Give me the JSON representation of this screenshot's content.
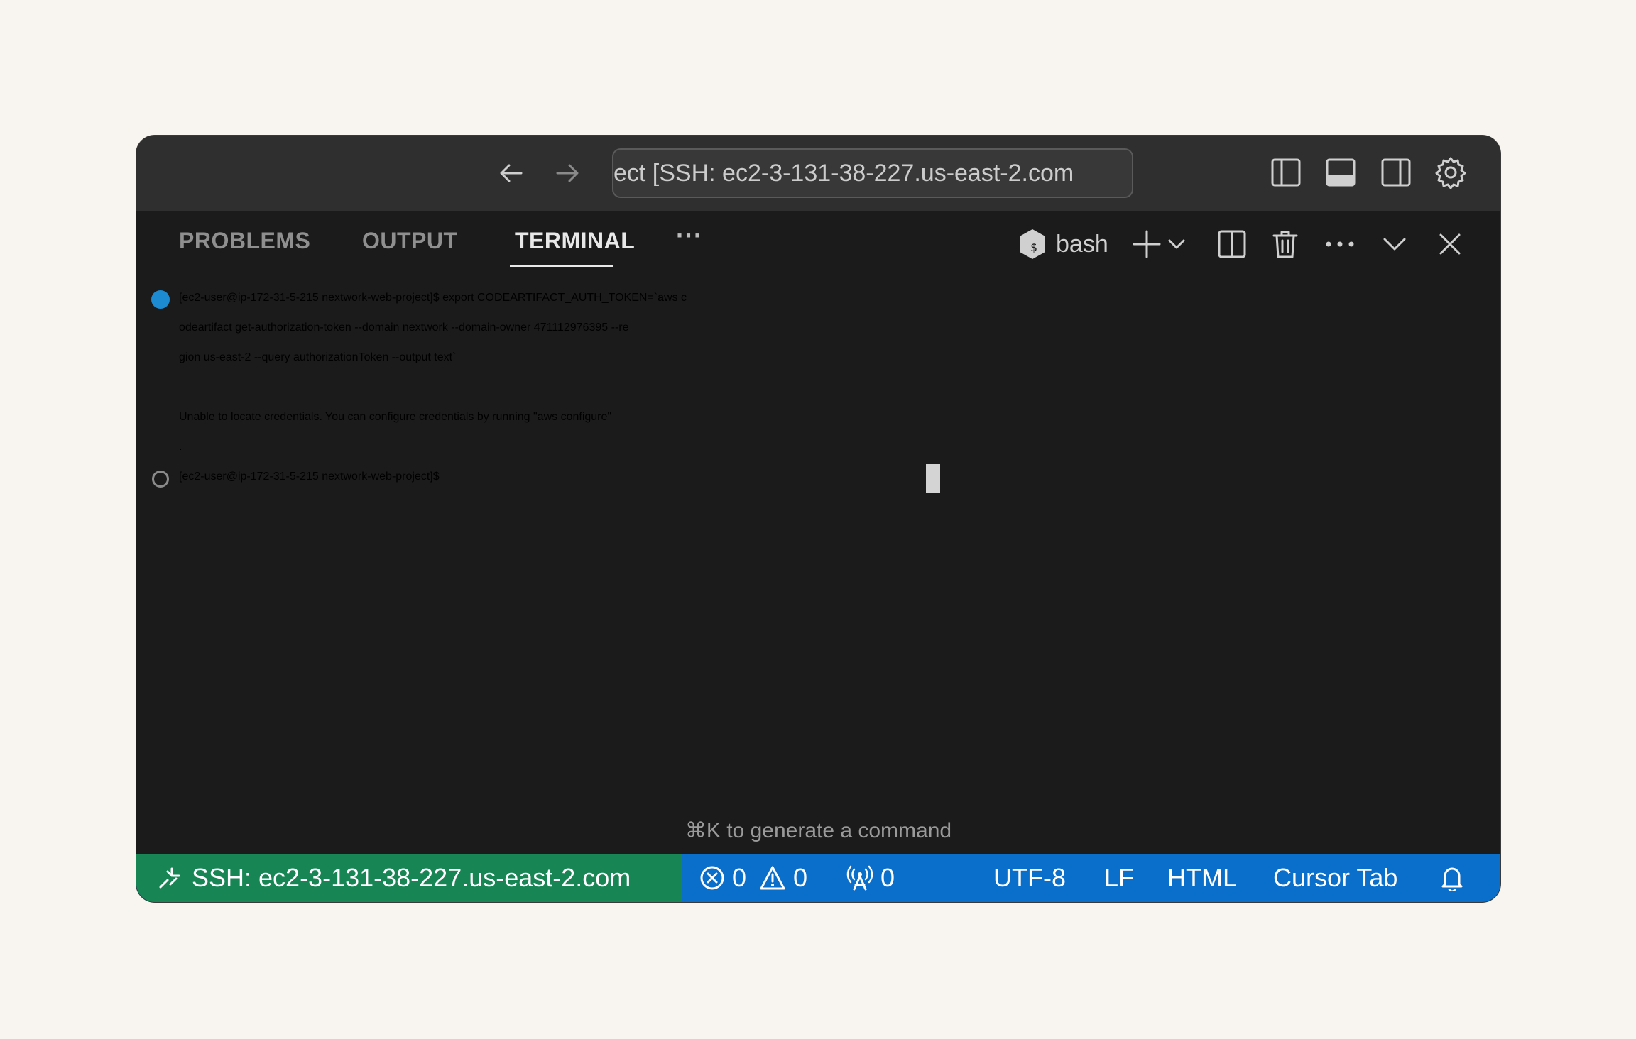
{
  "titlebar": {
    "command_center_text": "ect [SSH: ec2-3-131-38-227.us-east-2.com"
  },
  "panel": {
    "tabs": [
      {
        "label": "PROBLEMS",
        "active": false
      },
      {
        "label": "OUTPUT",
        "active": false
      },
      {
        "label": "TERMINAL",
        "active": true
      }
    ],
    "more_label": "···",
    "shell_name": "bash"
  },
  "terminal": {
    "lines": [
      "[ec2-user@ip-172-31-5-215 nextwork-web-project]$ export CODEARTIFACT_AUTH_TOKEN=`aws c",
      "odeartifact get-authorization-token --domain nextwork --domain-owner 471112976395 --re",
      "gion us-east-2 --query authorizationToken --output text`",
      "",
      "Unable to locate credentials. You can configure credentials by running \"aws configure\"",
      ".",
      "[ec2-user@ip-172-31-5-215 nextwork-web-project]$ "
    ],
    "hint": "⌘K to generate a command"
  },
  "statusbar": {
    "remote_label": "SSH: ec2-3-131-38-227.us-east-2.com",
    "errors": "0",
    "warnings": "0",
    "ports": "0",
    "encoding": "UTF-8",
    "eol": "LF",
    "language": "HTML",
    "cursor_tab": "Cursor Tab"
  },
  "colors": {
    "remote_bg": "#178554",
    "statusbar_bg": "#0a6ecb",
    "terminal_bg": "#1b1b1b",
    "titlebar_bg": "#2f2f2f",
    "success_dot": "#1d8bd1"
  }
}
